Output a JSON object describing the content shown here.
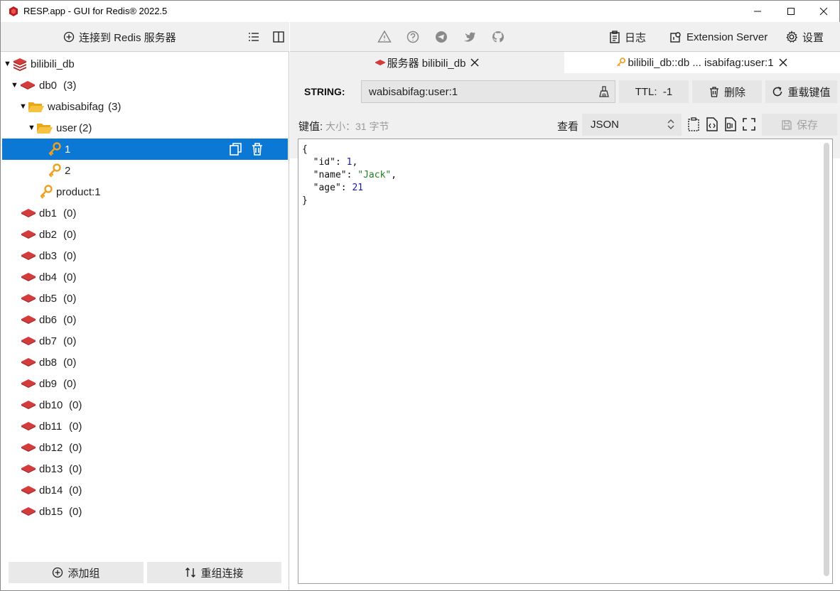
{
  "window": {
    "title": "RESP.app - GUI for Redis® 2022.5",
    "logo_color": "#c62828"
  },
  "left_toolbar": {
    "connect_label": "连接到 Redis 服务器"
  },
  "tree": {
    "server": "bilibili_db",
    "db0": {
      "name": "db0",
      "count": "(3)"
    },
    "folder_wabisabifag": {
      "name": "wabisabifag",
      "count": "(3)"
    },
    "folder_user": {
      "name": "user",
      "count": "(2)"
    },
    "key_1": "1",
    "key_2": "2",
    "key_product": "product:1",
    "databases": [
      {
        "name": "db1",
        "count": "(0)"
      },
      {
        "name": "db2",
        "count": "(0)"
      },
      {
        "name": "db3",
        "count": "(0)"
      },
      {
        "name": "db4",
        "count": "(0)"
      },
      {
        "name": "db5",
        "count": "(0)"
      },
      {
        "name": "db6",
        "count": "(0)"
      },
      {
        "name": "db7",
        "count": "(0)"
      },
      {
        "name": "db8",
        "count": "(0)"
      },
      {
        "name": "db9",
        "count": "(0)"
      },
      {
        "name": "db10",
        "count": "(0)"
      },
      {
        "name": "db11",
        "count": "(0)"
      },
      {
        "name": "db12",
        "count": "(0)"
      },
      {
        "name": "db13",
        "count": "(0)"
      },
      {
        "name": "db14",
        "count": "(0)"
      },
      {
        "name": "db15",
        "count": "(0)"
      }
    ]
  },
  "left_bottom": {
    "add_group_label": "添加组",
    "regroup_label": "重组连接"
  },
  "right_toolbar": {
    "log_label": "日志",
    "extension_label": "Extension Server",
    "settings_label": "设置"
  },
  "tabs": [
    {
      "label": "服务器 bilibili_db",
      "active": false
    },
    {
      "label": "bilibili_db::db ... isabifag:user:1",
      "active": true
    }
  ],
  "key": {
    "type": "STRING:",
    "name": "wabisabifag:user:1",
    "ttl": "TTL:  -1",
    "delete_label": "删除",
    "reload_label": "重载键值",
    "value_label": "键值:",
    "size_label": "大小：31 字节",
    "view_label": "查看",
    "view_mode": "JSON",
    "save_label": "保存"
  },
  "json_value": {
    "open": "{",
    "close": "}",
    "id_key": "\"id\"",
    "id_val": "1",
    "name_key": "\"name\"",
    "name_val": "\"Jack\"",
    "age_key": "\"age\"",
    "age_val": "21"
  },
  "colors": {
    "selection": "#0a78d4",
    "redis_red": "#d63b3b",
    "folder_yellow": "#f5c242",
    "key_orange": "#f0a020"
  }
}
